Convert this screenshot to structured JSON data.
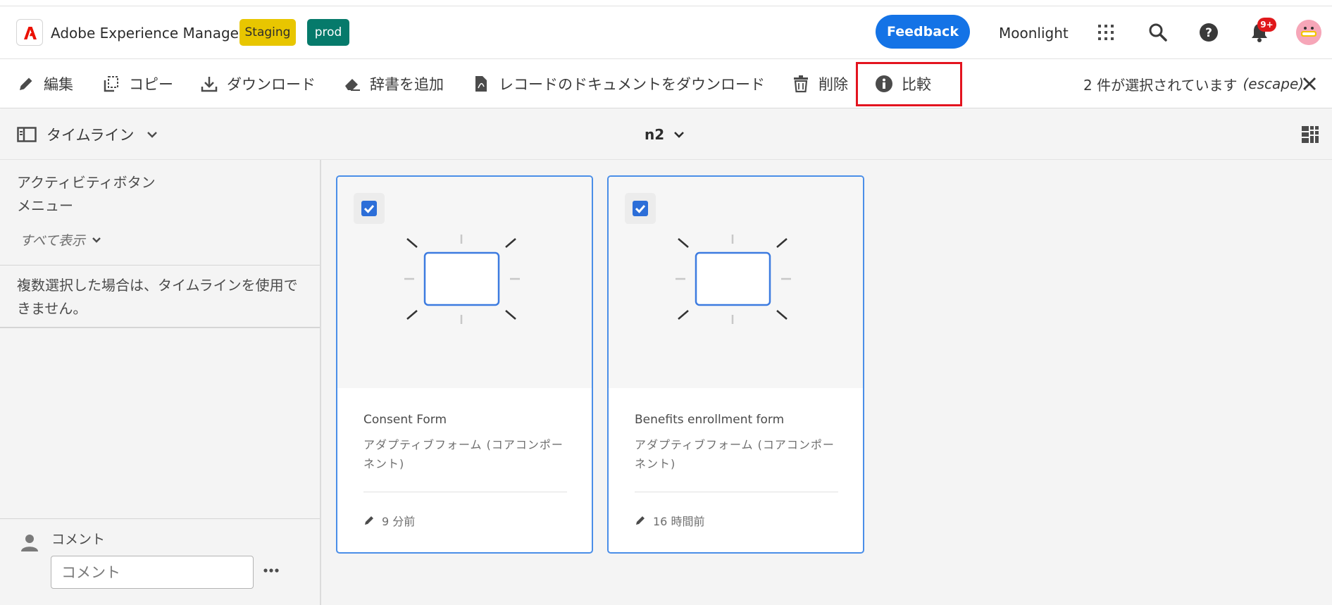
{
  "header": {
    "app_name": "Adobe Experience Manager",
    "badges": {
      "staging": "Staging",
      "prod": "prod"
    },
    "feedback_label": "Feedback",
    "org_name": "Moonlight",
    "notification_count": "9+",
    "colors": {
      "feedback": "#1473e6",
      "staging": "#e8c600",
      "prod": "#067a6b",
      "notification": "#e0181b"
    }
  },
  "actionbar": {
    "edit": "編集",
    "copy": "コピー",
    "download": "ダウンロード",
    "add_dictionary": "辞書を追加",
    "download_record_document": "レコードのドキュメントをダウンロード",
    "delete": "削除",
    "compare": "比較",
    "selection_count": "2 件が選択されています",
    "escape_hint": "(escape)"
  },
  "subheader": {
    "rail_view": "タイムライン",
    "breadcrumb": "n2"
  },
  "rail": {
    "title_line1": "アクティビティボタン",
    "title_line2": "メニュー",
    "show_all": "すべて表示",
    "message": "複数選択した場合は、タイムラインを使用できません。",
    "comment_label": "コメント",
    "comment_placeholder": "コメント"
  },
  "cards": [
    {
      "title": "Consent Form",
      "subtitle": "アダプティブフォーム (コアコンポーネント)",
      "modified": "9 分前",
      "selected": true
    },
    {
      "title": "Benefits enrollment form",
      "subtitle": "アダプティブフォーム (コアコンポーネント)",
      "modified": "16 時間前",
      "selected": true
    }
  ]
}
